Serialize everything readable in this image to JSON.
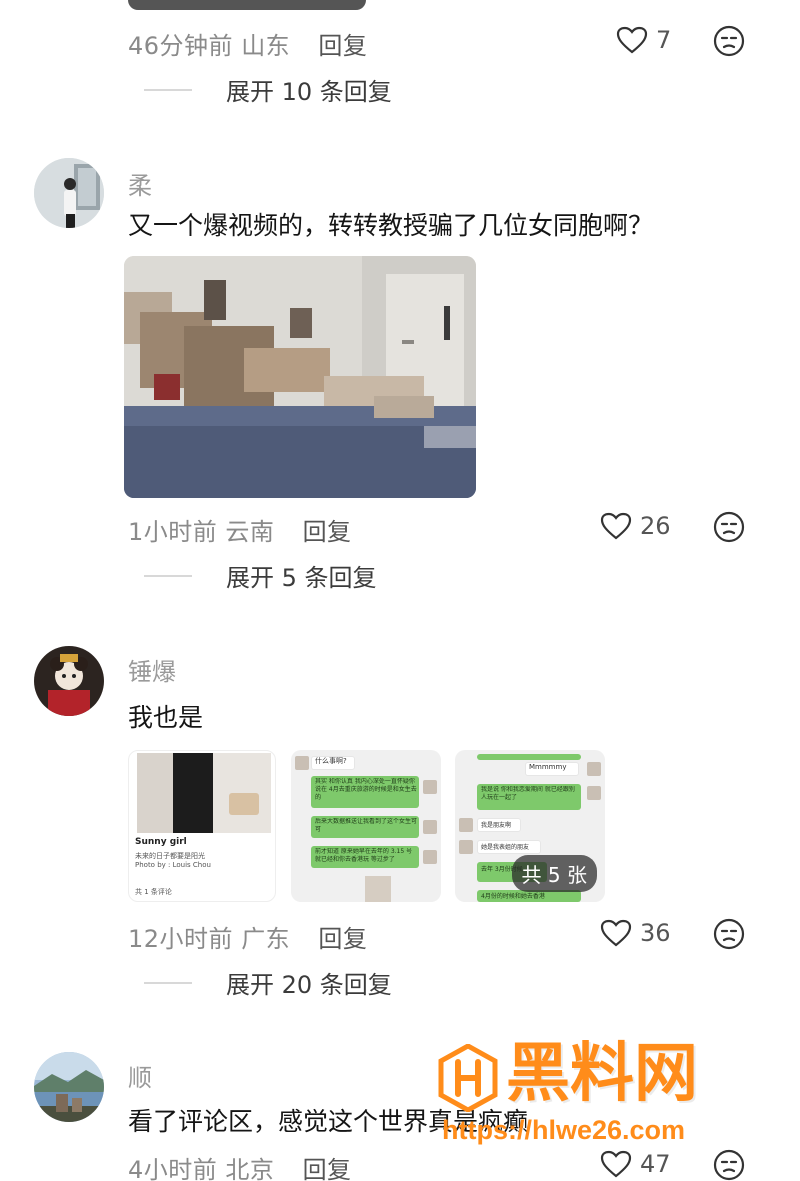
{
  "thread": {
    "comment0": {
      "time": "46分钟前",
      "location": "山东",
      "reply_label": "回复",
      "likes": "7",
      "expand_label": "展开 10 条回复"
    },
    "comment1": {
      "username": "柔",
      "text": "又一个爆视频的，转转教授骗了几位女同胞啊？",
      "time": "1小时前",
      "location": "云南",
      "reply_label": "回复",
      "likes": "26",
      "expand_label": "展开 5 条回复"
    },
    "comment2": {
      "username": "锤爆",
      "text": "我也是",
      "time": "12小时前",
      "location": "广东",
      "reply_label": "回复",
      "likes": "36",
      "expand_label": "展开 20 条回复",
      "images_badge": "共 5 张",
      "image1": {
        "title": "Sunny girl",
        "line1": "未来的日子都要是阳光",
        "line2": "Photo by : Louis Chou",
        "footer": "共 1 条评论"
      },
      "image2": {
        "header": "什么事啊?",
        "msg1": "其实 和你认真 我内心深处一直怀疑你说在 4月去重庆旅游的时候是和女生去的",
        "msg2": "后来大数据推送让我看到了这个女生可可",
        "msg3": "前才知道 原来她早在去年的 3.15 号就已经和你去香港玩 等过步了"
      },
      "image3": {
        "header": "Mmmmmy",
        "msg1": "我是说 你和我恋爱期间 就已经跟别人玩在一起了",
        "msg2": "我是朋友啊",
        "msg3": "她是我表姐的朋友",
        "msg4": "去年 3月份时候",
        "msg5": "4月份的时候和她去香港"
      }
    },
    "comment3": {
      "username": "顺",
      "text": "看了评论区，感觉这个世界真是疯癫",
      "time": "4小时前",
      "location": "北京",
      "reply_label": "回复",
      "likes": "47"
    }
  },
  "watermark": {
    "brand": "黑料网",
    "url": "https://hlwe26.com"
  },
  "icons": {
    "like": "heart-outline-icon",
    "react": "unamused-face-icon"
  },
  "colors": {
    "meta_text": "#8a8a8a",
    "watermark": "#ff8c1a",
    "chat_green": "#7ec96b"
  }
}
